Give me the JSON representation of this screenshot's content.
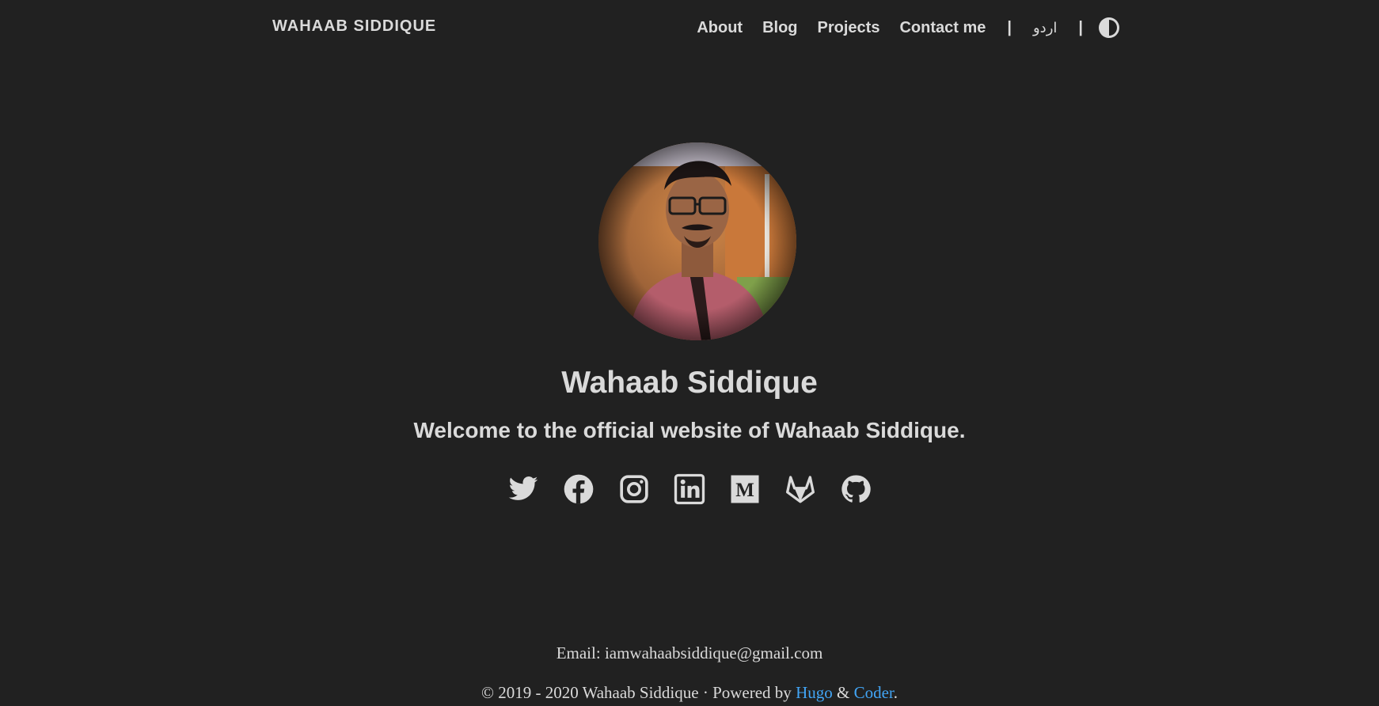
{
  "nav": {
    "brand": "WAHAAB SIDDIQUE",
    "links": [
      "About",
      "Blog",
      "Projects",
      "Contact me"
    ],
    "separator": "|",
    "language": "اردو",
    "theme_toggle_icon": "contrast-icon"
  },
  "profile": {
    "avatar_icon": "profile-photo",
    "name": "Wahaab Siddique",
    "tagline": "Welcome to the official website of Wahaab Siddique."
  },
  "social": [
    "twitter-icon",
    "facebook-icon",
    "instagram-icon",
    "linkedin-icon",
    "medium-icon",
    "gitlab-icon",
    "github-icon"
  ],
  "footer": {
    "email": "Email: iamwahaabsiddique@gmail.com",
    "copyright": "© 2019 - 2020 Wahaab Siddique · Powered by ",
    "hugo": "Hugo",
    "amp": " & ",
    "coder": "Coder",
    "period": "."
  },
  "colors": {
    "background": "#212121",
    "text": "#dadada",
    "link": "#42a5f5"
  }
}
